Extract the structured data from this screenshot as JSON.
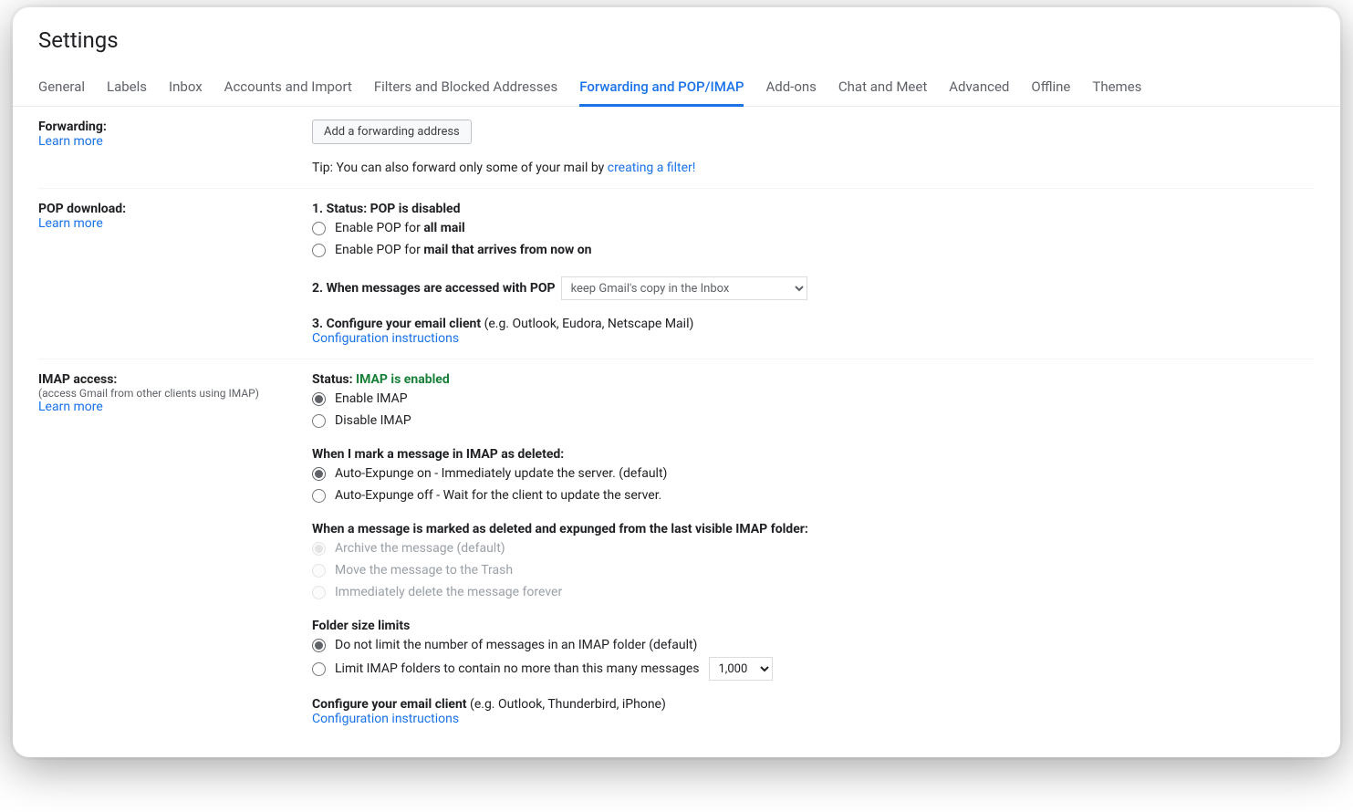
{
  "page": {
    "title": "Settings"
  },
  "tabs": [
    {
      "label": "General",
      "active": false
    },
    {
      "label": "Labels",
      "active": false
    },
    {
      "label": "Inbox",
      "active": false
    },
    {
      "label": "Accounts and Import",
      "active": false
    },
    {
      "label": "Filters and Blocked Addresses",
      "active": false
    },
    {
      "label": "Forwarding and POP/IMAP",
      "active": true
    },
    {
      "label": "Add-ons",
      "active": false
    },
    {
      "label": "Chat and Meet",
      "active": false
    },
    {
      "label": "Advanced",
      "active": false
    },
    {
      "label": "Offline",
      "active": false
    },
    {
      "label": "Themes",
      "active": false
    }
  ],
  "forwarding": {
    "heading": "Forwarding:",
    "learn_more": "Learn more",
    "add_button": "Add a forwarding address",
    "tip_prefix": "Tip: You can also forward only some of your mail by ",
    "tip_link": "creating a filter!"
  },
  "pop": {
    "heading": "POP download:",
    "learn_more": "Learn more",
    "status_label": "1. Status: ",
    "status_value": "POP is disabled",
    "opt1_prefix": "Enable POP for ",
    "opt1_bold": "all mail",
    "opt2_prefix": "Enable POP for ",
    "opt2_bold": "mail that arrives from now on",
    "when_heading": "2. When messages are accessed with POP",
    "when_selected": "keep Gmail's copy in the Inbox",
    "configure_heading": "3. Configure your email client ",
    "configure_note": "(e.g. Outlook, Eudora, Netscape Mail)",
    "configure_link": "Configuration instructions"
  },
  "imap": {
    "heading": "IMAP access:",
    "subnote": "(access Gmail from other clients using IMAP)",
    "learn_more": "Learn more",
    "status_label": "Status: ",
    "status_value": "IMAP is enabled",
    "opt_enable": "Enable IMAP",
    "opt_disable": "Disable IMAP",
    "del_heading": "When I mark a message in IMAP as deleted:",
    "del_opt1": "Auto-Expunge on - Immediately update the server. (default)",
    "del_opt2": "Auto-Expunge off - Wait for the client to update the server.",
    "expunge_heading": "When a message is marked as deleted and expunged from the last visible IMAP folder:",
    "exp_opt1": "Archive the message (default)",
    "exp_opt2": "Move the message to the Trash",
    "exp_opt3": "Immediately delete the message forever",
    "folder_heading": "Folder size limits",
    "folder_opt1": "Do not limit the number of messages in an IMAP folder (default)",
    "folder_opt2_text": "Limit IMAP folders to contain no more than this many messages",
    "folder_limit_selected": "1,000",
    "configure_heading": "Configure your email client ",
    "configure_note": "(e.g. Outlook, Thunderbird, iPhone)",
    "configure_link": "Configuration instructions"
  }
}
